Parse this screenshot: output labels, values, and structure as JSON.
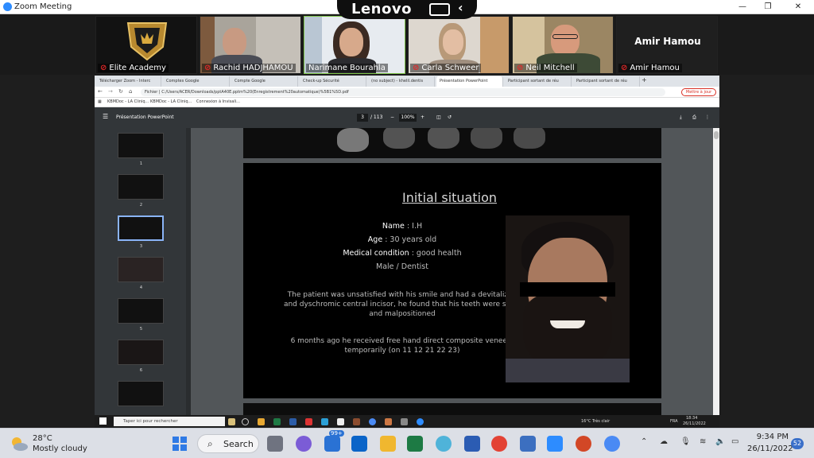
{
  "zoom": {
    "window_title": "Zoom Meeting",
    "controls": {
      "minimize": "—",
      "restore": "❐",
      "close": "✕"
    }
  },
  "lenovo": {
    "brand": "Lenovo"
  },
  "participants": [
    {
      "name": "Elite Academy",
      "muted": true
    },
    {
      "name": "Rachid HADJHAMOU",
      "muted": true
    },
    {
      "name": "Narimane Bourahla",
      "muted": false
    },
    {
      "name": "Carla Schweer",
      "muted": true
    },
    {
      "name": "Neil Mitchell",
      "muted": true
    },
    {
      "name": "Amir Hamou",
      "muted": true
    }
  ],
  "active_speaker_name": "Amir Hamou",
  "browser": {
    "tabs": [
      "Télécharger Zoom - Interc",
      "Comptes Google",
      "Compte Google",
      "Check-up Sécurité",
      "(no subject) - khelil.dentis",
      "Présentation PowerPoint",
      "Participant sortant de réu",
      "Participant sortant de réu"
    ],
    "url": "Fichier | C:/Users/ACER/Downloads/pptA40E.pptm%20(Enregistrement%20automatique)%5B1%5D.pdf",
    "update_label": "Mettre à jour",
    "bookmarks": [
      "KBMDoc - LA Cliniq...",
      "KBMDoc - LA Cliniq...",
      "Connexion à Invisali..."
    ]
  },
  "pdf": {
    "title": "Présentation PowerPoint",
    "current_page": "3",
    "total_pages": "/ 113",
    "zoom": "100%",
    "thumb_numbers": [
      "1",
      "2",
      "3",
      "4",
      "5",
      "6"
    ]
  },
  "slide": {
    "heading": "Initial situation",
    "name_label": "Name",
    "name_value": ": I.H",
    "age_label": "Age",
    "age_value": ": 30 years old",
    "condition_label": "Medical condition",
    "condition_value": ": good health",
    "profile": "Male / Dentist",
    "paragraph1": "The patient was unsatisfied with his smile and had a devitalized and dyschromic central incisor, he found that his teeth were short and malpositioned",
    "paragraph2": "6 months ago he received free hand direct composite veneers temporarily (on 11 12 21 22 23)"
  },
  "remote_taskbar": {
    "search_placeholder": "Taper ici pour rechercher",
    "weather": "16°C  Très clair",
    "lang": "FRA",
    "time": "18:34",
    "date": "26/11/2022"
  },
  "taskbar": {
    "temperature": "28°C",
    "weather": "Mostly cloudy",
    "search_label": "Search",
    "mail_badge": "99+",
    "time": "9:34 PM",
    "date": "26/11/2022",
    "notifications": "52"
  }
}
